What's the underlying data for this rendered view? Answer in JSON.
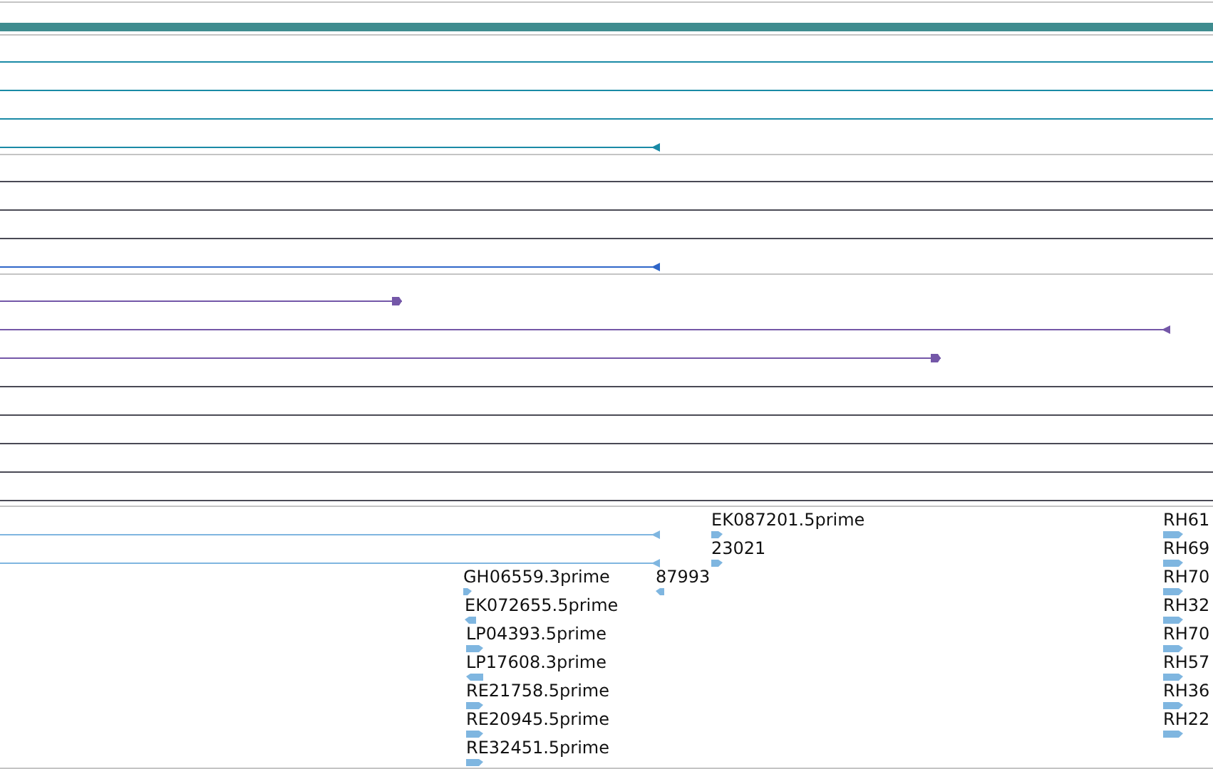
{
  "tracks": [
    {
      "features": [
        {
          "kind": "span",
          "color": "#1a8aa6"
        },
        {
          "kind": "span",
          "color": "#1a8aa6"
        },
        {
          "kind": "span",
          "color": "#1a8aa6"
        },
        {
          "kind": "end",
          "reverse": true,
          "color": "#1a8aa6"
        }
      ]
    },
    {
      "features": [
        {
          "kind": "span",
          "color": "#4a4a55"
        },
        {
          "kind": "span",
          "color": "#4a4a55"
        },
        {
          "kind": "span",
          "color": "#4a4a55"
        },
        {
          "kind": "end",
          "reverse": true,
          "color": "#2f66c8"
        }
      ]
    },
    {
      "features": [
        {
          "kind": "end",
          "reverse": false,
          "color": "#7457a8"
        },
        {
          "kind": "end",
          "reverse": true,
          "color": "#7457a8"
        },
        {
          "kind": "end",
          "reverse": false,
          "color": "#7457a8"
        },
        {
          "kind": "span",
          "color": "#4a4a55"
        },
        {
          "kind": "span",
          "color": "#4a4a55"
        },
        {
          "kind": "span",
          "color": "#4a4a55"
        },
        {
          "kind": "span",
          "color": "#4a4a55"
        },
        {
          "kind": "span",
          "color": "#4a4a55"
        }
      ]
    },
    {
      "features": [
        {
          "kind": "end",
          "reverse": true,
          "color": "#7fb6e0"
        },
        {
          "kind": "end",
          "reverse": true,
          "color": "#7fb6e0"
        }
      ]
    }
  ],
  "labeled_features": [
    {
      "label": "EK087201.5prime",
      "reverse": false
    },
    {
      "label": "23021",
      "reverse": false
    },
    {
      "label": "GH06559.3prime",
      "reverse": false
    },
    {
      "label": "87993",
      "reverse": true
    },
    {
      "label": "EK072655.5prime",
      "reverse": true
    },
    {
      "label": "LP04393.5prime",
      "reverse": false
    },
    {
      "label": "LP17608.3prime",
      "reverse": true
    },
    {
      "label": "RE21758.5prime",
      "reverse": false
    },
    {
      "label": "RE20945.5prime",
      "reverse": false
    },
    {
      "label": "RE32451.5prime",
      "reverse": false
    },
    {
      "label": "RH61",
      "reverse": false
    },
    {
      "label": "RH69",
      "reverse": false
    },
    {
      "label": "RH70",
      "reverse": false
    },
    {
      "label": "RH32",
      "reverse": false
    },
    {
      "label": "RH70",
      "reverse": false
    },
    {
      "label": "RH57",
      "reverse": false
    },
    {
      "label": "RH36",
      "reverse": false
    },
    {
      "label": "RH22",
      "reverse": false
    }
  ]
}
